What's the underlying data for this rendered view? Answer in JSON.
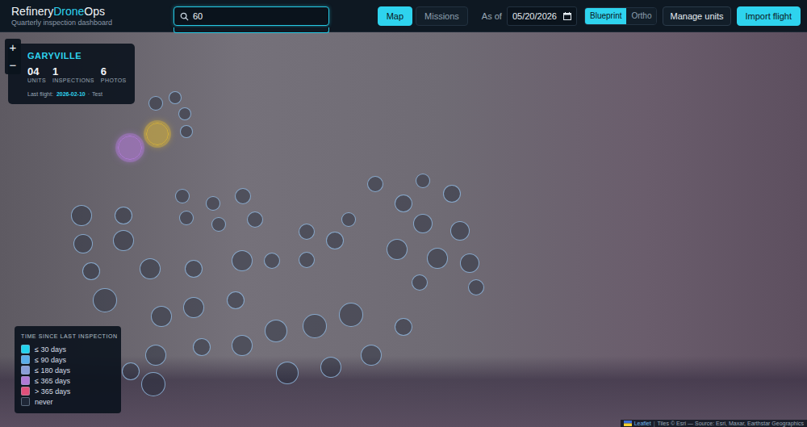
{
  "app": {
    "brand": [
      {
        "text": "Refinery",
        "accent": false
      },
      {
        "text": "Drone",
        "accent": true
      },
      {
        "text": "Ops",
        "accent": false
      }
    ],
    "subtitle": "Quarterly inspection dashboard"
  },
  "search": {
    "value": "60",
    "dropdown_open": true
  },
  "nav_tabs": [
    {
      "label": "Map",
      "selected": true
    },
    {
      "label": "Missions",
      "selected": false
    }
  ],
  "as_of": {
    "label": "As of",
    "date": "05/20/2026"
  },
  "view_toggle": [
    {
      "label": "Blueprint",
      "selected": true
    },
    {
      "label": "Ortho",
      "selected": false
    }
  ],
  "actions": [
    {
      "label": "Manage units",
      "kind": "secondary"
    },
    {
      "label": "Import flight",
      "kind": "primary"
    }
  ],
  "zoom": {
    "in": "+",
    "out": "−"
  },
  "site_card": {
    "name": "GARYVILLE",
    "stats": [
      {
        "value": "04",
        "label": "UNITS"
      },
      {
        "value": "1",
        "label": "INSPECTIONS"
      },
      {
        "value": "6",
        "label": "PHOTOS"
      }
    ],
    "last_flight_label": "Last flight:",
    "last_flight_date": "2026-02-10",
    "last_flight_sep": "·",
    "last_flight_name": "Test"
  },
  "map": {
    "units": [
      {
        "color": "#b07ad6",
        "selected": true
      },
      {
        "color": "#d4b13c",
        "selected": true
      },
      {
        "color": "#1f2737",
        "selected": false
      },
      {
        "color": "#1f2737",
        "selected": false
      },
      {
        "color": "#1f2737",
        "selected": false
      },
      {
        "color": "#1f2737",
        "selected": false
      },
      {
        "color": "#1f2737",
        "selected": false
      },
      {
        "color": "#1f2737",
        "selected": false
      },
      {
        "color": "#1f2737",
        "selected": false
      },
      {
        "color": "#1f2737",
        "selected": false
      },
      {
        "color": "#1f2737",
        "selected": false
      },
      {
        "color": "#1f2737",
        "selected": false
      },
      {
        "color": "#1f2737",
        "selected": false
      },
      {
        "color": "#1f2737",
        "selected": false
      },
      {
        "color": "#1f2737",
        "selected": false
      },
      {
        "color": "#1f2737",
        "selected": false
      },
      {
        "color": "#1f2737",
        "selected": false
      },
      {
        "color": "#1f2737",
        "selected": false
      },
      {
        "color": "#1f2737",
        "selected": false
      },
      {
        "color": "#1f2737",
        "selected": false
      },
      {
        "color": "#1f2737",
        "selected": false
      },
      {
        "color": "#1f2737",
        "selected": false
      },
      {
        "color": "#1f2737",
        "selected": false
      },
      {
        "color": "#1f2737",
        "selected": false
      },
      {
        "color": "#1f2737",
        "selected": false
      },
      {
        "color": "#1f2737",
        "selected": false
      },
      {
        "color": "#1f2737",
        "selected": false
      },
      {
        "color": "#1f2737",
        "selected": false
      },
      {
        "color": "#1f2737",
        "selected": false
      },
      {
        "color": "#1f2737",
        "selected": false
      },
      {
        "color": "#1f2737",
        "selected": false
      },
      {
        "color": "#1f2737",
        "selected": false
      },
      {
        "color": "#1f2737",
        "selected": false
      },
      {
        "color": "#1f2737",
        "selected": false
      },
      {
        "color": "#1f2737",
        "selected": false
      },
      {
        "color": "#1f2737",
        "selected": false
      },
      {
        "color": "#1f2737",
        "selected": false
      },
      {
        "color": "#1f2737",
        "selected": false
      },
      {
        "color": "#1f2737",
        "selected": false
      },
      {
        "color": "#1f2737",
        "selected": false
      },
      {
        "color": "#1f2737",
        "selected": false
      },
      {
        "color": "#1f2737",
        "selected": false
      },
      {
        "color": "#1f2737",
        "selected": false
      },
      {
        "color": "#1f2737",
        "selected": false
      },
      {
        "color": "#1f2737",
        "selected": false
      },
      {
        "color": "#1f2737",
        "selected": false
      },
      {
        "color": "#1f2737",
        "selected": false
      },
      {
        "color": "#1f2737",
        "selected": false
      },
      {
        "color": "#1f2737",
        "selected": false
      },
      {
        "color": "#1f2737",
        "selected": false
      },
      {
        "color": "#1f2737",
        "selected": false
      },
      {
        "color": "#1f2737",
        "selected": false
      }
    ]
  },
  "legend": {
    "title": "TIME SINCE LAST INSPECTION",
    "items": [
      {
        "label": "≤ 30 days",
        "color": "#22d3ee"
      },
      {
        "label": "≤ 90 days",
        "color": "#5aaeea"
      },
      {
        "label": "≤ 180 days",
        "color": "#8a9ed8"
      },
      {
        "label": "≤ 365 days",
        "color": "#b07ad6"
      },
      {
        "label": "> 365 days",
        "color": "#e0507a"
      },
      {
        "label": "never",
        "color": "#1f2737"
      }
    ]
  },
  "attribution": {
    "leaflet": "Leaflet",
    "separator": "|",
    "tiles": "Tiles © Esri — Source: Esri, Maxar, Earthstar Geographics"
  }
}
